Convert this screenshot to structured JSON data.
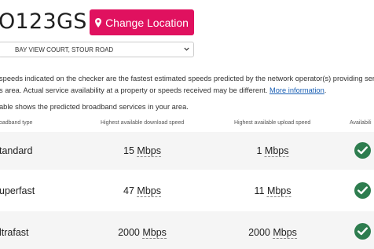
{
  "header": {
    "postcode": "O123GS",
    "change_location_label": "Change Location",
    "change_location_icon": "map-marker-icon",
    "accent_color": "#e0115f"
  },
  "address_select": {
    "selected": "BAY VIEW COURT, STOUR ROAD"
  },
  "disclaimer": {
    "line1": "speeds indicated on the checker are the fastest estimated speeds predicted by the network operator(s) providing servic",
    "line2_prefix": "s area. Actual service availability at a property or speeds received may be different. ",
    "more_info_link": "More information",
    "line2_suffix": "."
  },
  "intro_text": "able shows the predicted broadband services in your area.",
  "table": {
    "headers": {
      "type": "oadband type",
      "download": "Highest available download speed",
      "upload": "Highest available upload speed",
      "availability": "Availabili"
    },
    "rows": [
      {
        "type": "tandard",
        "download_value": "15",
        "download_unit": "Mbps",
        "upload_value": "1",
        "upload_unit": "Mbps",
        "available_icon": "check-circle-icon"
      },
      {
        "type": "uperfast",
        "download_value": "47",
        "download_unit": "Mbps",
        "upload_value": "11",
        "upload_unit": "Mbps",
        "available_icon": "check-circle-icon"
      },
      {
        "type": "ltrafast",
        "download_value": "2000",
        "download_unit": "Mbps",
        "upload_value": "2000",
        "upload_unit": "Mbps",
        "available_icon": "check-circle-icon"
      }
    ],
    "check_color": "#2e7d4f"
  }
}
